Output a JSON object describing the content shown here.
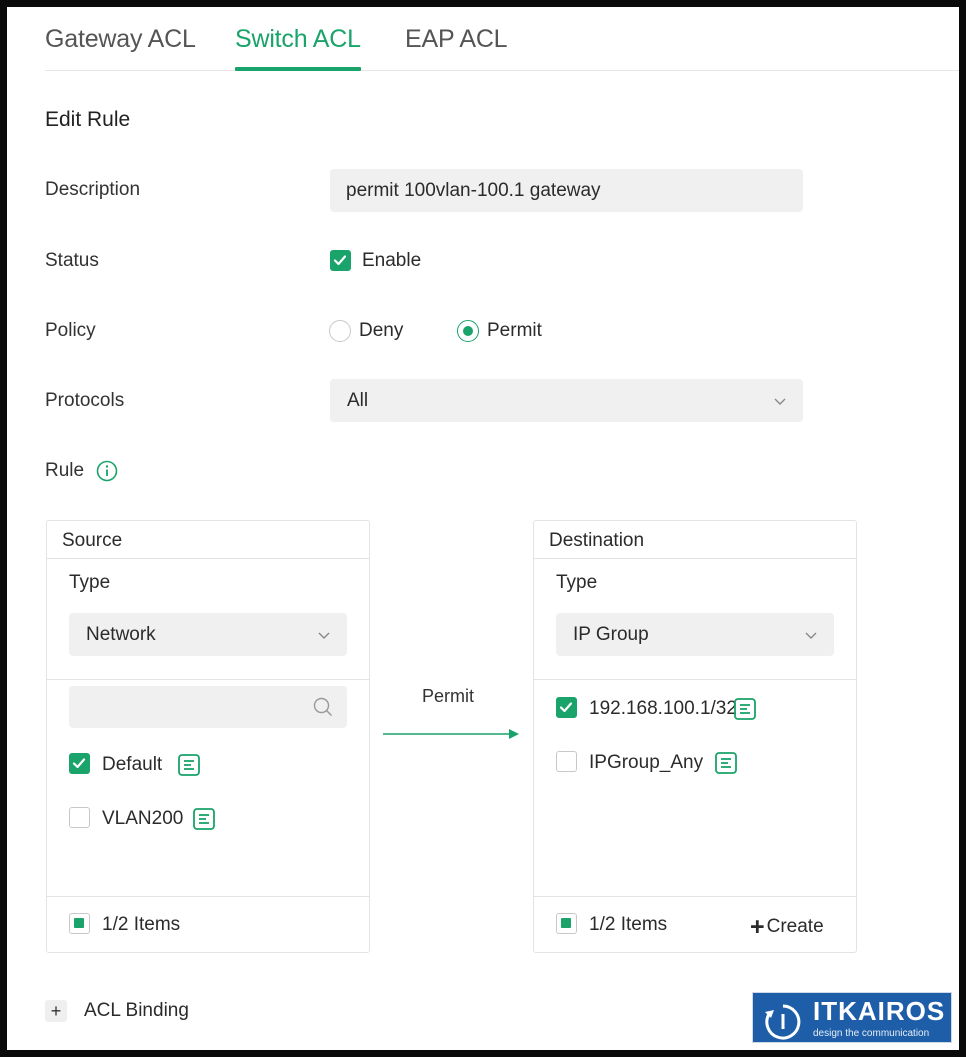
{
  "tabs": [
    {
      "label": "Gateway ACL",
      "active": false
    },
    {
      "label": "Switch ACL",
      "active": true
    },
    {
      "label": "EAP ACL",
      "active": false
    }
  ],
  "form": {
    "title": "Edit Rule",
    "description_label": "Description",
    "description_value": "permit 100vlan-100.1 gateway",
    "status_label": "Status",
    "status_option": "Enable",
    "status_checked": true,
    "policy_label": "Policy",
    "policy_options": [
      "Deny",
      "Permit"
    ],
    "policy_selected": "Permit",
    "protocols_label": "Protocols",
    "protocols_value": "All",
    "rule_label": "Rule"
  },
  "source": {
    "header": "Source",
    "type_label": "Type",
    "type_value": "Network",
    "search_placeholder": "",
    "items": [
      {
        "label": "Default",
        "checked": true
      },
      {
        "label": "VLAN200",
        "checked": false
      }
    ],
    "footer": "1/2 Items"
  },
  "flow": {
    "label": "Permit"
  },
  "destination": {
    "header": "Destination",
    "type_label": "Type",
    "type_value": "IP Group",
    "items": [
      {
        "label": "192.168.100.1/32",
        "checked": true
      },
      {
        "label": "IPGroup_Any",
        "checked": false
      }
    ],
    "footer": "1/2 Items",
    "create_label": "Create"
  },
  "acl_binding": {
    "label": "ACL Binding"
  },
  "logo": {
    "name": "ITKAIROS",
    "tagline": "design the communication"
  },
  "colors": {
    "accent": "#1aa36a",
    "logo_bg": "#1e5ea8"
  }
}
